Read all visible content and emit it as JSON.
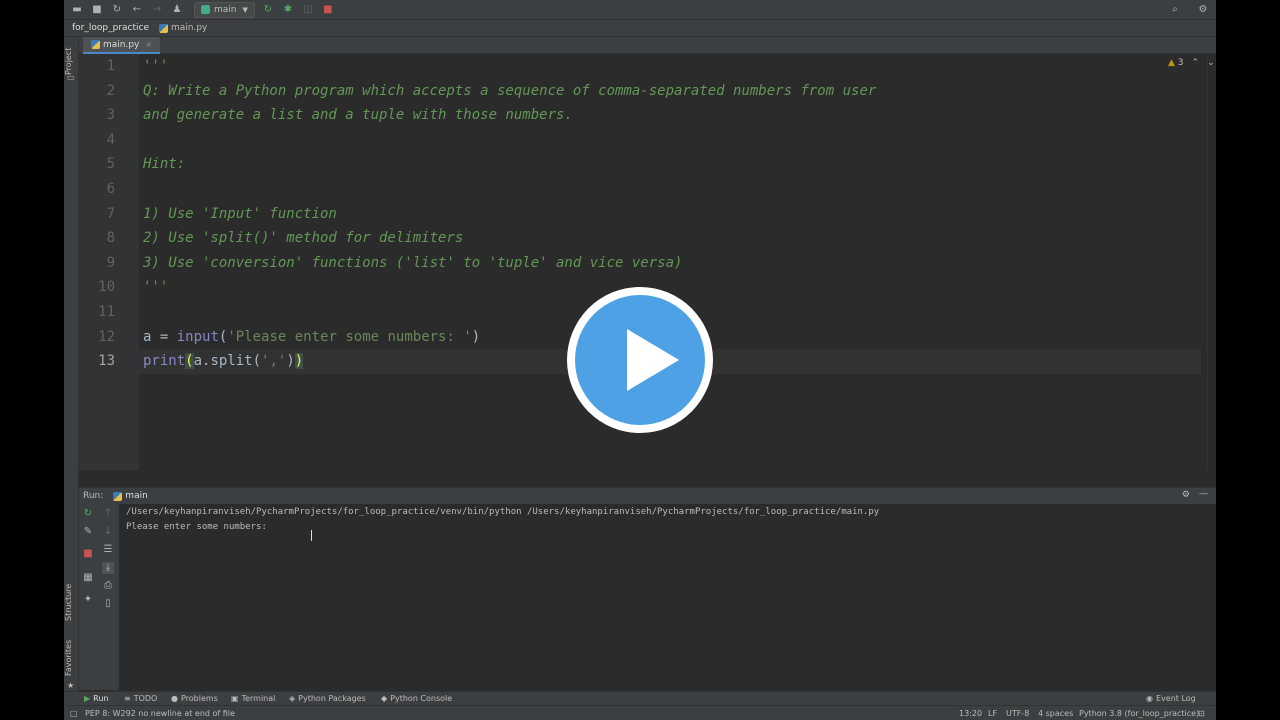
{
  "toolbar": {
    "run_config": "main"
  },
  "navbar": {
    "project": "for_loop_practice",
    "file": "main.py"
  },
  "left_strip": {
    "project_label": "Project",
    "structure_label": "Structure",
    "favorites_label": "Favorites"
  },
  "tabs": [
    {
      "label": "main.py"
    }
  ],
  "editor": {
    "warning_count": "3",
    "line_numbers": [
      "1",
      "2",
      "3",
      "4",
      "5",
      "6",
      "7",
      "8",
      "9",
      "10",
      "11",
      "12",
      "13"
    ],
    "lines": {
      "l1": "'''",
      "l2": "Q: Write a Python program which accepts a sequence of comma-separated numbers from user",
      "l3": "and generate a list and a tuple with those numbers.",
      "l5": "Hint:",
      "l7": "1) Use 'Input' function",
      "l8": "2) Use 'split()' method for delimiters",
      "l9": "3) Use 'conversion' functions ('list' to 'tuple' and vice versa)",
      "l10": "'''",
      "l12_var": "a",
      "l12_eq": " = ",
      "l12_fn": "input",
      "l12_open": "(",
      "l12_str": "'Please enter some numbers: '",
      "l12_close": ")",
      "l13_fn": "print",
      "l13_open": "(",
      "l13_mid": "a.split(",
      "l13_str": "','",
      "l13_close1": ")",
      "l13_close2": ")"
    }
  },
  "run_panel": {
    "label": "Run:",
    "config": "main",
    "console_lines": [
      "/Users/keyhanpiranviseh/PycharmProjects/for_loop_practice/venv/bin/python /Users/keyhanpiranviseh/PycharmProjects/for_loop_practice/main.py",
      "Please enter some numbers: "
    ]
  },
  "bottom_tabs": {
    "run": "Run",
    "todo": "TODO",
    "problems": "Problems",
    "terminal": "Terminal",
    "packages": "Python Packages",
    "console": "Python Console",
    "event_log": "Event Log"
  },
  "status": {
    "message": "PEP 8: W292 no newline at end of file",
    "position": "13:20",
    "line_sep": "LF",
    "encoding": "UTF-8",
    "indent": "4 spaces",
    "interpreter": "Python 3.8 (for_loop_practice)"
  },
  "colors": {
    "editor_bg": "#2b2b2b",
    "comment": "#629755",
    "play_button": "#4fa1e6"
  }
}
